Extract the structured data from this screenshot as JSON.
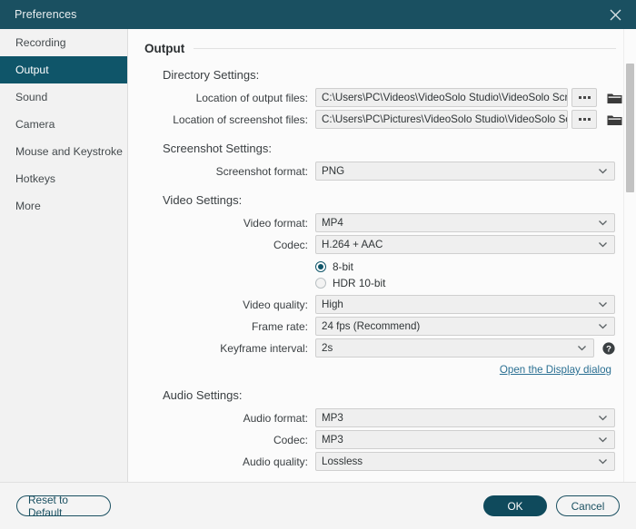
{
  "window": {
    "title": "Preferences",
    "close_icon": "close-icon"
  },
  "sidebar": {
    "items": [
      {
        "label": "Recording",
        "active": false
      },
      {
        "label": "Output",
        "active": true
      },
      {
        "label": "Sound",
        "active": false
      },
      {
        "label": "Camera",
        "active": false
      },
      {
        "label": "Mouse and Keystroke",
        "active": false
      },
      {
        "label": "Hotkeys",
        "active": false
      },
      {
        "label": "More",
        "active": false
      }
    ]
  },
  "main": {
    "page_title": "Output",
    "directory": {
      "heading": "Directory Settings:",
      "output_files": {
        "label": "Location of output files:",
        "value": "C:\\Users\\PC\\Videos\\VideoSolo Studio\\VideoSolo Screen Re",
        "browse_label": "...",
        "folder_icon": "folder-icon"
      },
      "screenshot_files": {
        "label": "Location of screenshot files:",
        "value": "C:\\Users\\PC\\Pictures\\VideoSolo Studio\\VideoSolo Screen R",
        "browse_label": "...",
        "folder_icon": "folder-icon"
      }
    },
    "screenshot": {
      "heading": "Screenshot Settings:",
      "format": {
        "label": "Screenshot format:",
        "value": "PNG"
      }
    },
    "video": {
      "heading": "Video Settings:",
      "format": {
        "label": "Video format:",
        "value": "MP4"
      },
      "codec": {
        "label": "Codec:",
        "value": "H.264 + AAC"
      },
      "bitdepth": {
        "options": [
          {
            "label": "8-bit",
            "selected": true
          },
          {
            "label": "HDR 10-bit",
            "selected": false
          }
        ]
      },
      "quality": {
        "label": "Video quality:",
        "value": "High"
      },
      "framerate": {
        "label": "Frame rate:",
        "value": "24 fps (Recommend)"
      },
      "keyframe": {
        "label": "Keyframe interval:",
        "value": "2s"
      },
      "help_icon": "help-icon",
      "display_link": "Open the Display dialog"
    },
    "audio": {
      "heading": "Audio Settings:",
      "format": {
        "label": "Audio format:",
        "value": "MP3"
      },
      "codec": {
        "label": "Codec:",
        "value": "MP3"
      },
      "quality": {
        "label": "Audio quality:",
        "value": "Lossless"
      }
    }
  },
  "footer": {
    "reset_label": "Reset to Default",
    "ok_label": "OK",
    "cancel_label": "Cancel"
  },
  "colors": {
    "titlebar": "#1a5061",
    "accent": "#0f5569",
    "link": "#2a6f92",
    "primary_button": "#0f4a5c"
  }
}
